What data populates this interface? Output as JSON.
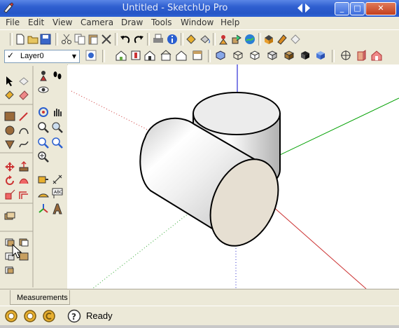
{
  "window": {
    "title": "Untitled - SketchUp Pro",
    "buttons": {
      "minimize": "_",
      "maximize": "□",
      "close": "✕"
    }
  },
  "menu": [
    {
      "label": "File"
    },
    {
      "label": "Edit"
    },
    {
      "label": "View"
    },
    {
      "label": "Camera"
    },
    {
      "label": "Draw"
    },
    {
      "label": "Tools"
    },
    {
      "label": "Window"
    },
    {
      "label": "Help"
    }
  ],
  "layers": {
    "current": "Layer0",
    "active_check": "✓"
  },
  "measurements": {
    "label": "Measurements"
  },
  "status": {
    "text": "Ready"
  },
  "colors": {
    "chrome": "#ece9d8",
    "titlebar": "#2656c6",
    "axis_red": "#cc0000",
    "axis_green": "#00a000",
    "axis_blue": "#0000cc",
    "face_back": "#e6dfd2"
  }
}
